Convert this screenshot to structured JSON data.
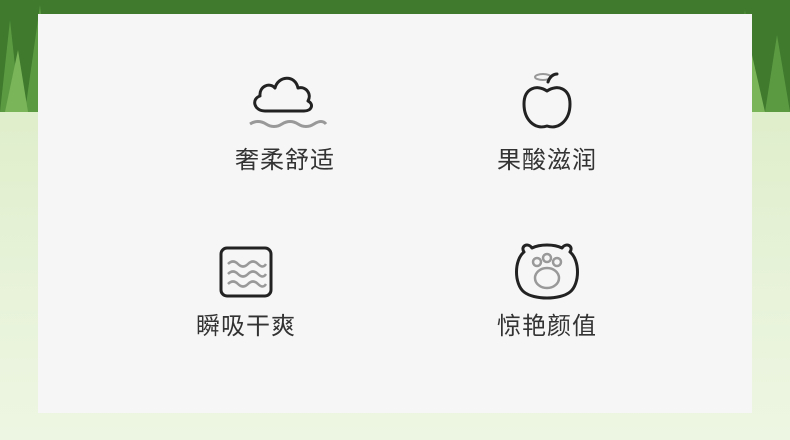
{
  "features": [
    {
      "icon": "cloud-icon",
      "label": "奢柔舒适"
    },
    {
      "icon": "apple-icon",
      "label": "果酸滋润"
    },
    {
      "icon": "wave-square-icon",
      "label": "瞬吸干爽"
    },
    {
      "icon": "bear-paw-icon",
      "label": "惊艳颜值"
    }
  ]
}
